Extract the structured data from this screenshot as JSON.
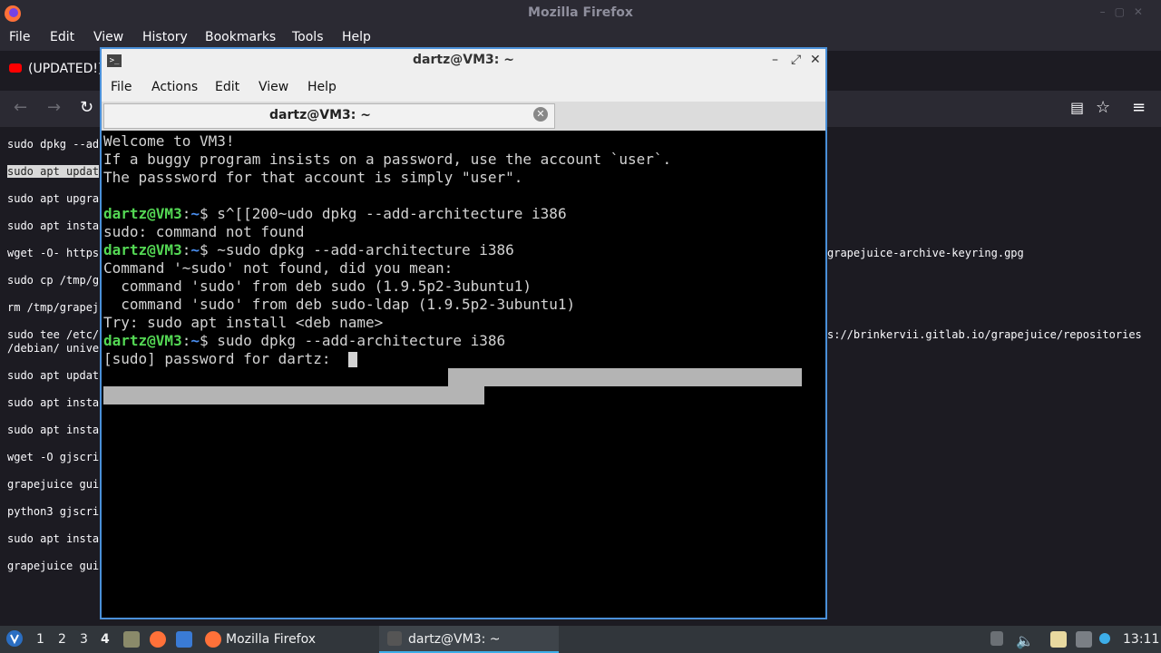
{
  "firefox": {
    "title": "Mozilla Firefox",
    "menu": [
      "File",
      "Edit",
      "View",
      "History",
      "Bookmarks",
      "Tools",
      "Help"
    ],
    "tab_title": "(UPDATED!)",
    "page_lines_left": [
      "sudo dpkg --ad",
      "sudo apt updat",
      "sudo apt upgra",
      "sudo apt insta",
      "wget -O- https",
      "sudo cp /tmp/g",
      "rm /tmp/grapej",
      "sudo tee /etc/",
      "/debian/ unive",
      "sudo apt updat",
      "sudo apt insta",
      "sudo apt insta",
      "wget -O gjscri",
      "grapejuice gui",
      "python3 gjscri",
      "sudo apt insta",
      "grapejuice gui"
    ],
    "page_lines_right": [
      "grapejuice-archive-keyring.gpg",
      "s://brinkervii.gitlab.io/grapejuice/repositories"
    ]
  },
  "terminal": {
    "title": "dartz@VM3: ~",
    "menu": [
      "File",
      "Actions",
      "Edit",
      "View",
      "Help"
    ],
    "tab_label": "dartz@VM3: ~",
    "prompt_user": "dartz@VM3",
    "prompt_sep": ":",
    "prompt_path": "~",
    "prompt_symbol": "$",
    "lines": {
      "l1": "Welcome to VM3!",
      "l2": "If a buggy program insists on a password, use the account `user`.",
      "l3": "The passsword for that account is simply \"user\".",
      "cmd1": " s^[[200~udo dpkg --add-architecture i386",
      "out1": "sudo: command not found",
      "cmd2": " ~sudo dpkg --add-architecture i386",
      "out2": "Command '~sudo' not found, did you mean:",
      "out3": "  command 'sudo' from deb sudo (1.9.5p2-3ubuntu1)",
      "out4": "  command 'sudo' from deb sudo-ldap (1.9.5p2-3ubuntu1)",
      "out5": "Try: sudo apt install <deb name>",
      "cmd3": " sudo dpkg --add-architecture i386",
      "out6": "[sudo] password for dartz: "
    }
  },
  "taskbar": {
    "workspaces": [
      "1",
      "2",
      "3",
      "4"
    ],
    "active_workspace": "4",
    "task_firefox": "Mozilla Firefox",
    "task_terminal": "dartz@VM3: ~",
    "clock": "13:11"
  }
}
